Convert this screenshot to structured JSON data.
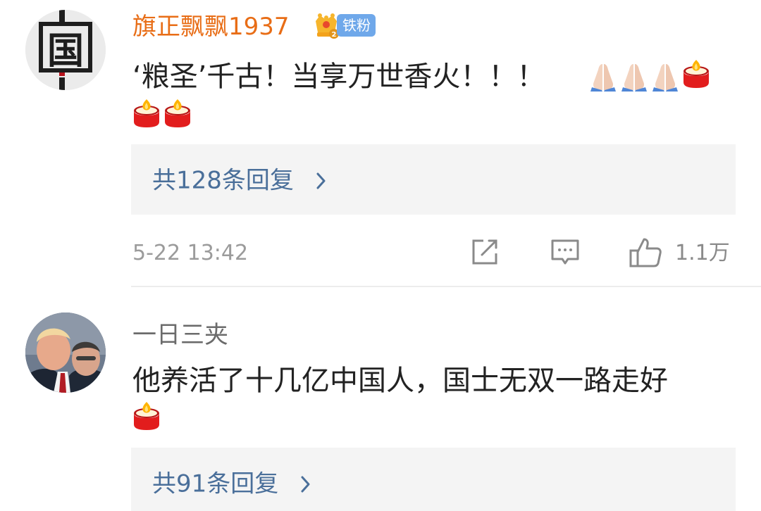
{
  "comments": [
    {
      "username": "旗正飘飘1937",
      "fan_badge": "铁粉",
      "fan_level_icon": "crown-badge-icon",
      "avatar_icon": "guo-character-avatar",
      "avatar_text": "国",
      "text_line1": "‘粮圣’千古！当享万世香火！！！",
      "emojis": [
        "pray",
        "pray",
        "pray",
        "candle",
        "candle",
        "candle"
      ],
      "replies_label": "共128条回复",
      "timestamp": "5-22 13:42",
      "like_count": "1.1万"
    },
    {
      "username": "一日三夹",
      "avatar_icon": "photo-avatar",
      "text_line1": "他养活了十几亿中国人，国士无双一路走好",
      "emojis": [
        "candle"
      ],
      "replies_label": "共91条回复"
    }
  ],
  "icons": {
    "share": "share-icon",
    "comment": "comment-icon",
    "like": "thumbs-up-icon",
    "chevron": "chevron-right-icon"
  },
  "colors": {
    "username_highlight": "#e86d16",
    "badge": "#6fa8ea",
    "reply_link": "#4a6f9a",
    "reply_bg": "#f4f4f4"
  }
}
